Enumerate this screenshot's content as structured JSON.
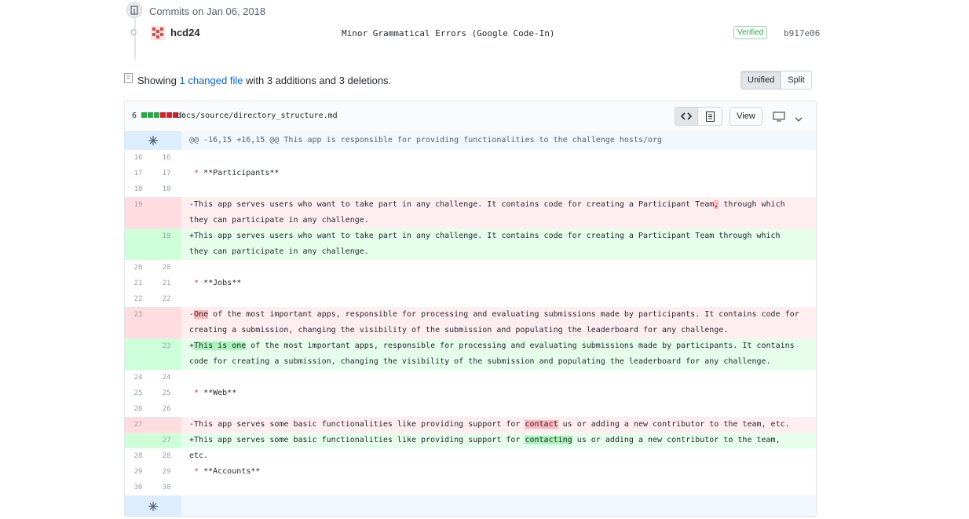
{
  "commits_heading": "Commits on Jan 06, 2018",
  "commit": {
    "author": "hcd24",
    "message": "Minor Grammatical Errors (Google Code-In)",
    "verified_label": "Verified",
    "sha": "b917e06"
  },
  "summary": {
    "prefix": "Showing",
    "changed_files": "1 changed file",
    "with": "with",
    "additions": "3 additions",
    "and": "and",
    "deletions": "3 deletions",
    "period": "."
  },
  "view_toggle": {
    "unified": "Unified",
    "split": "Split",
    "selected": "Unified"
  },
  "file": {
    "changes_count": "6",
    "path": "docs/source/directory_structure.md",
    "view_label": "View",
    "diffstat_colors": [
      "#28a745",
      "#28a745",
      "#28a745",
      "#cb2431",
      "#cb2431",
      "#cb2431",
      "#d1d5da"
    ]
  },
  "hunk_header": "@@ -16,15 +16,15 @@ This app is responsible for providing functionalities to the challenge hosts/org",
  "lines": {
    "l16": {
      "old": "16",
      "new": "16",
      "text": ""
    },
    "l17": {
      "old": "17",
      "new": "17",
      "bullet": "*",
      "text": " **Participants**"
    },
    "l18": {
      "old": "18",
      "new": "18",
      "text": ""
    },
    "d19": {
      "old": "19",
      "sign": "-",
      "pre": "This app serves users who want to take part in any challenge. It contains code for creating a Participant Team",
      "hl": ",",
      "post": " through which they can participate in any challenge."
    },
    "a19": {
      "new": "19",
      "sign": "+",
      "text": "This app serves users who want to take part in any challenge. It contains code for creating a Participant Team through which they can participate in any challenge."
    },
    "l20": {
      "old": "20",
      "new": "20",
      "text": ""
    },
    "l21": {
      "old": "21",
      "new": "21",
      "bullet": "*",
      "text": " **Jobs**"
    },
    "l22": {
      "old": "22",
      "new": "22",
      "text": ""
    },
    "d23": {
      "old": "23",
      "sign": "-",
      "hl": "One",
      "post": " of the most important apps, responsible for processing and evaluating submissions made by participants. It contains code for creating a submission, changing the visibility of the submission and populating the leaderboard for any challenge."
    },
    "a23": {
      "new": "23",
      "sign": "+",
      "hl": "This is one",
      "post": " of the most important apps, responsible for processing and evaluating submissions made by participants. It contains code for creating a submission, changing the visibility of the submission and populating the leaderboard for any challenge."
    },
    "l24": {
      "old": "24",
      "new": "24",
      "text": ""
    },
    "l25": {
      "old": "25",
      "new": "25",
      "bullet": "*",
      "text": " **Web**"
    },
    "l26": {
      "old": "26",
      "new": "26",
      "text": ""
    },
    "d27": {
      "old": "27",
      "sign": "-",
      "pre": "This app serves some basic functionalities like providing support for ",
      "hl": "contact",
      "post": " us or adding a new contributor to the team, etc."
    },
    "a27": {
      "new": "27",
      "sign": "+",
      "pre": "This app serves some basic functionalities like providing support for ",
      "hl": "contacting",
      "post": " us or adding a new contributor to the team, etc."
    },
    "l28": {
      "old": "28",
      "new": "28",
      "text": ""
    },
    "l29": {
      "old": "29",
      "new": "29",
      "bullet": "*",
      "text": " **Accounts**"
    },
    "l30": {
      "old": "30",
      "new": "30",
      "text": ""
    }
  }
}
